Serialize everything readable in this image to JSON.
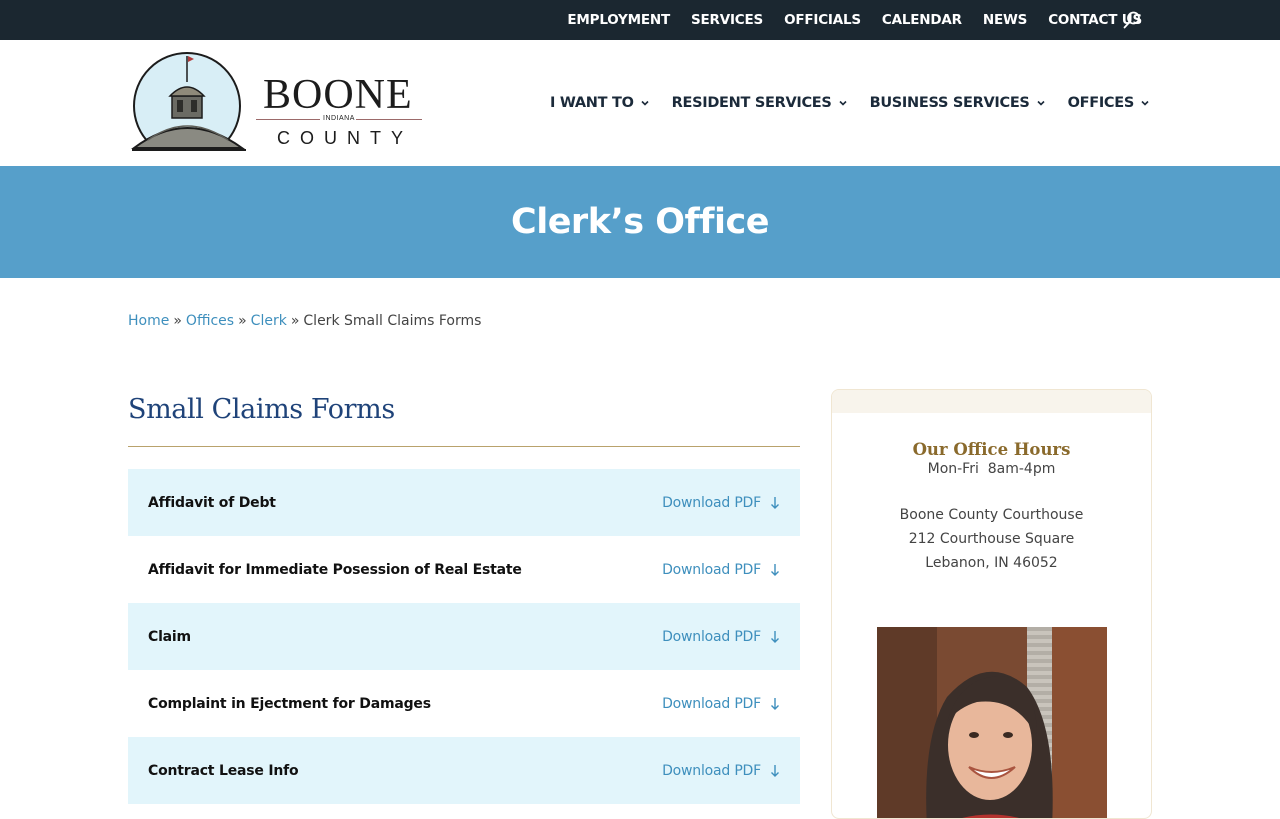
{
  "topbar": {
    "links": [
      "EMPLOYMENT",
      "SERVICES",
      "OFFICIALS",
      "CALENDAR",
      "NEWS",
      "CONTACT US"
    ],
    "search_icon": "search-icon"
  },
  "logo": {
    "line1": "BOONE",
    "line2": "INDIANA",
    "line3": "COUNTY"
  },
  "mainnav": {
    "items": [
      "I WANT TO",
      "RESIDENT SERVICES",
      "BUSINESS SERVICES",
      "OFFICES"
    ]
  },
  "hero": {
    "title": "Clerk’s Office"
  },
  "breadcrumb": {
    "items": [
      "Home",
      "Offices",
      "Clerk"
    ],
    "current": "Clerk Small Claims Forms",
    "separator": "»"
  },
  "main": {
    "heading": "Small Claims Forms",
    "forms": [
      {
        "name": "Affidavit of Debt",
        "action": "Download PDF"
      },
      {
        "name": "Affidavit for Immediate Posession of Real Estate",
        "action": "Download PDF"
      },
      {
        "name": "Claim",
        "action": "Download PDF"
      },
      {
        "name": "Complaint in Ejectment for Damages",
        "action": "Download PDF"
      },
      {
        "name": "Contract Lease Info",
        "action": "Download PDF"
      }
    ]
  },
  "sidebar": {
    "title": "Our Office Hours",
    "hours": "Mon-Fri  8am-4pm",
    "address": [
      "Boone County Courthouse",
      "212 Courthouse Square",
      "Lebanon, IN 46052"
    ]
  },
  "colors": {
    "topbar_bg": "#1b2730",
    "hero_bg": "#569fca",
    "link": "#3e8fbd",
    "heading": "#1f4379",
    "shaded_row": "#e2f5fb",
    "sidebar_title": "#8a6a2c"
  }
}
